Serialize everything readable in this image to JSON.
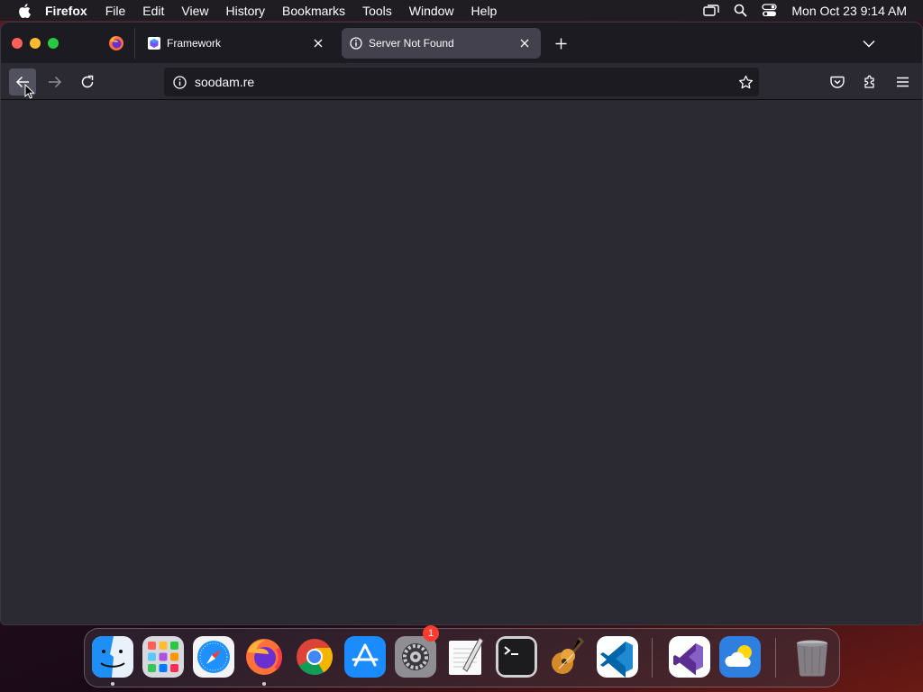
{
  "menubar": {
    "app_name": "Firefox",
    "items": [
      "File",
      "Edit",
      "View",
      "History",
      "Bookmarks",
      "Tools",
      "Window",
      "Help"
    ],
    "clock": "Mon Oct 23  9:14 AM"
  },
  "tabs": [
    {
      "title": "Framework",
      "icon": "framework-favicon"
    },
    {
      "title": "Server Not Found",
      "icon": "info-icon",
      "active": true
    }
  ],
  "navbar": {
    "url": "soodam.re"
  },
  "dock": {
    "apps": [
      {
        "name": "Finder",
        "icon": "finder-icon",
        "running": true
      },
      {
        "name": "Launchpad",
        "icon": "launchpad-icon"
      },
      {
        "name": "Safari",
        "icon": "safari-icon"
      },
      {
        "name": "Firefox",
        "icon": "firefox-icon",
        "running": true
      },
      {
        "name": "Chrome",
        "icon": "chrome-icon"
      },
      {
        "name": "App Store",
        "icon": "app-store-icon"
      },
      {
        "name": "System Settings",
        "icon": "system-settings-icon",
        "badge": "1"
      },
      {
        "name": "TextEdit",
        "icon": "textedit-icon"
      },
      {
        "name": "Terminal",
        "icon": "terminal-icon"
      },
      {
        "name": "GarageBand",
        "icon": "garageband-icon"
      },
      {
        "name": "Visual Studio Code",
        "icon": "vscode-icon"
      },
      {
        "name": "Visual Studio",
        "icon": "visual-studio-icon"
      },
      {
        "name": "Weather",
        "icon": "weather-icon"
      },
      {
        "name": "Trash",
        "icon": "trash-icon"
      }
    ]
  },
  "colors": {
    "window_bg": "#2b2a33",
    "tabbar_bg": "#1c1b22",
    "active_tab": "#42414d",
    "badge": "#ff3b30"
  }
}
